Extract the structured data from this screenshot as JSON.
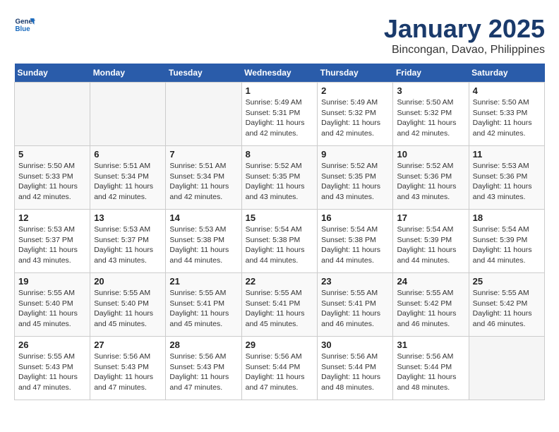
{
  "header": {
    "logo_line1": "General",
    "logo_line2": "Blue",
    "title": "January 2025",
    "subtitle": "Bincongan, Davao, Philippines"
  },
  "days_of_week": [
    "Sunday",
    "Monday",
    "Tuesday",
    "Wednesday",
    "Thursday",
    "Friday",
    "Saturday"
  ],
  "weeks": [
    [
      {
        "day": "",
        "info": ""
      },
      {
        "day": "",
        "info": ""
      },
      {
        "day": "",
        "info": ""
      },
      {
        "day": "1",
        "info": "Sunrise: 5:49 AM\nSunset: 5:31 PM\nDaylight: 11 hours and 42 minutes."
      },
      {
        "day": "2",
        "info": "Sunrise: 5:49 AM\nSunset: 5:32 PM\nDaylight: 11 hours and 42 minutes."
      },
      {
        "day": "3",
        "info": "Sunrise: 5:50 AM\nSunset: 5:32 PM\nDaylight: 11 hours and 42 minutes."
      },
      {
        "day": "4",
        "info": "Sunrise: 5:50 AM\nSunset: 5:33 PM\nDaylight: 11 hours and 42 minutes."
      }
    ],
    [
      {
        "day": "5",
        "info": "Sunrise: 5:50 AM\nSunset: 5:33 PM\nDaylight: 11 hours and 42 minutes."
      },
      {
        "day": "6",
        "info": "Sunrise: 5:51 AM\nSunset: 5:34 PM\nDaylight: 11 hours and 42 minutes."
      },
      {
        "day": "7",
        "info": "Sunrise: 5:51 AM\nSunset: 5:34 PM\nDaylight: 11 hours and 42 minutes."
      },
      {
        "day": "8",
        "info": "Sunrise: 5:52 AM\nSunset: 5:35 PM\nDaylight: 11 hours and 43 minutes."
      },
      {
        "day": "9",
        "info": "Sunrise: 5:52 AM\nSunset: 5:35 PM\nDaylight: 11 hours and 43 minutes."
      },
      {
        "day": "10",
        "info": "Sunrise: 5:52 AM\nSunset: 5:36 PM\nDaylight: 11 hours and 43 minutes."
      },
      {
        "day": "11",
        "info": "Sunrise: 5:53 AM\nSunset: 5:36 PM\nDaylight: 11 hours and 43 minutes."
      }
    ],
    [
      {
        "day": "12",
        "info": "Sunrise: 5:53 AM\nSunset: 5:37 PM\nDaylight: 11 hours and 43 minutes."
      },
      {
        "day": "13",
        "info": "Sunrise: 5:53 AM\nSunset: 5:37 PM\nDaylight: 11 hours and 43 minutes."
      },
      {
        "day": "14",
        "info": "Sunrise: 5:53 AM\nSunset: 5:38 PM\nDaylight: 11 hours and 44 minutes."
      },
      {
        "day": "15",
        "info": "Sunrise: 5:54 AM\nSunset: 5:38 PM\nDaylight: 11 hours and 44 minutes."
      },
      {
        "day": "16",
        "info": "Sunrise: 5:54 AM\nSunset: 5:38 PM\nDaylight: 11 hours and 44 minutes."
      },
      {
        "day": "17",
        "info": "Sunrise: 5:54 AM\nSunset: 5:39 PM\nDaylight: 11 hours and 44 minutes."
      },
      {
        "day": "18",
        "info": "Sunrise: 5:54 AM\nSunset: 5:39 PM\nDaylight: 11 hours and 44 minutes."
      }
    ],
    [
      {
        "day": "19",
        "info": "Sunrise: 5:55 AM\nSunset: 5:40 PM\nDaylight: 11 hours and 45 minutes."
      },
      {
        "day": "20",
        "info": "Sunrise: 5:55 AM\nSunset: 5:40 PM\nDaylight: 11 hours and 45 minutes."
      },
      {
        "day": "21",
        "info": "Sunrise: 5:55 AM\nSunset: 5:41 PM\nDaylight: 11 hours and 45 minutes."
      },
      {
        "day": "22",
        "info": "Sunrise: 5:55 AM\nSunset: 5:41 PM\nDaylight: 11 hours and 45 minutes."
      },
      {
        "day": "23",
        "info": "Sunrise: 5:55 AM\nSunset: 5:41 PM\nDaylight: 11 hours and 46 minutes."
      },
      {
        "day": "24",
        "info": "Sunrise: 5:55 AM\nSunset: 5:42 PM\nDaylight: 11 hours and 46 minutes."
      },
      {
        "day": "25",
        "info": "Sunrise: 5:55 AM\nSunset: 5:42 PM\nDaylight: 11 hours and 46 minutes."
      }
    ],
    [
      {
        "day": "26",
        "info": "Sunrise: 5:55 AM\nSunset: 5:43 PM\nDaylight: 11 hours and 47 minutes."
      },
      {
        "day": "27",
        "info": "Sunrise: 5:56 AM\nSunset: 5:43 PM\nDaylight: 11 hours and 47 minutes."
      },
      {
        "day": "28",
        "info": "Sunrise: 5:56 AM\nSunset: 5:43 PM\nDaylight: 11 hours and 47 minutes."
      },
      {
        "day": "29",
        "info": "Sunrise: 5:56 AM\nSunset: 5:44 PM\nDaylight: 11 hours and 47 minutes."
      },
      {
        "day": "30",
        "info": "Sunrise: 5:56 AM\nSunset: 5:44 PM\nDaylight: 11 hours and 48 minutes."
      },
      {
        "day": "31",
        "info": "Sunrise: 5:56 AM\nSunset: 5:44 PM\nDaylight: 11 hours and 48 minutes."
      },
      {
        "day": "",
        "info": ""
      }
    ]
  ]
}
